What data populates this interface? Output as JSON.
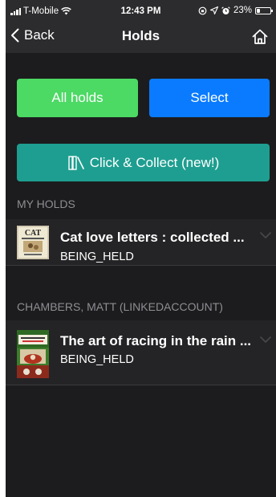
{
  "status_bar": {
    "carrier": "T-Mobile",
    "time": "12:43 PM",
    "battery": "23%",
    "battery_level": 0.23
  },
  "nav": {
    "back_label": "Back",
    "title": "Holds"
  },
  "buttons": {
    "all_holds": "All holds",
    "select": "Select",
    "click_collect": "Click & Collect (new!)"
  },
  "sections": [
    {
      "header": "MY HOLDS",
      "items": [
        {
          "title": "Cat love letters : collected ...",
          "status": "BEING_HELD"
        }
      ]
    },
    {
      "header": "CHAMBERS, MATT (LINKEDACCOUNT)",
      "items": [
        {
          "title": "The art of racing in the rain ...",
          "status": "BEING_HELD"
        }
      ]
    }
  ],
  "colors": {
    "all_holds": "#4cd964",
    "select": "#0a7bff",
    "click_collect": "#1e9e90",
    "background": "#1c1c1e",
    "header_text": "#8e8e93"
  },
  "icons": {
    "back": "chevron-left-icon",
    "home": "home-icon",
    "books": "books-icon",
    "row_chevron": "chevron-down-icon"
  }
}
